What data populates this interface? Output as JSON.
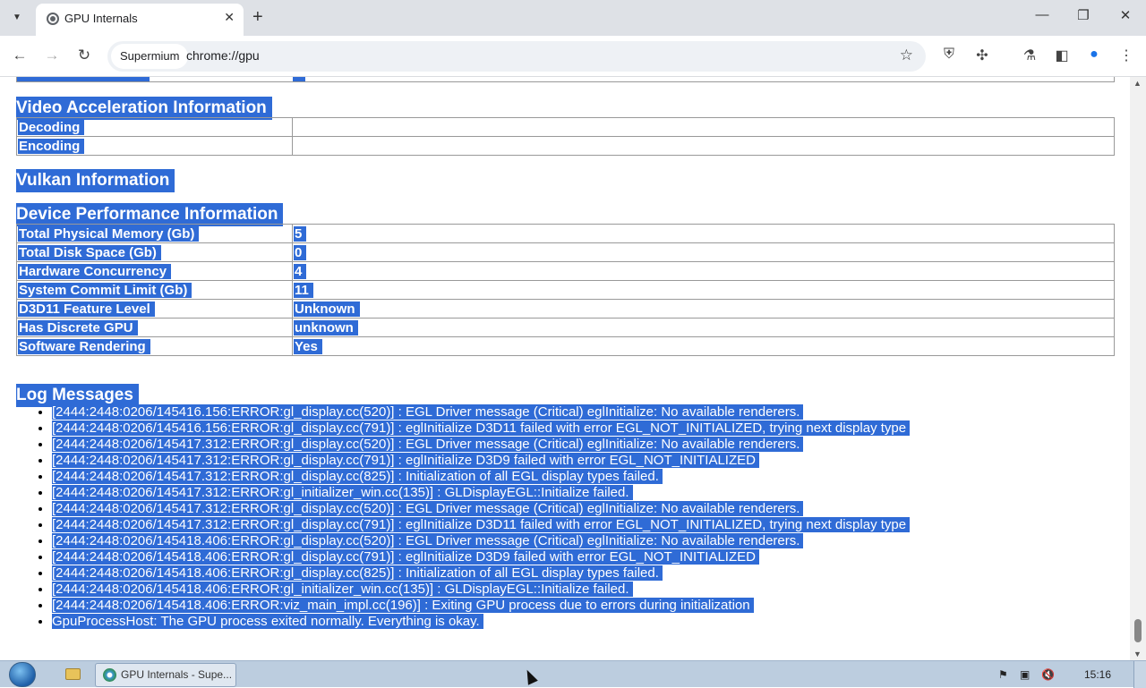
{
  "tab": {
    "title": "GPU Internals",
    "close": "✕",
    "new_tab": "+"
  },
  "window_controls": {
    "minimize": "—",
    "restore": "❐",
    "close": "✕"
  },
  "toolbar": {
    "site_chip": "Supermium",
    "url": "chrome://gpu"
  },
  "sections": {
    "video": {
      "title": "Video Acceleration Information",
      "rows": [
        {
          "key": "Decoding",
          "value": ""
        },
        {
          "key": "Encoding",
          "value": ""
        }
      ]
    },
    "vulkan": {
      "title": "Vulkan Information"
    },
    "device": {
      "title": "Device Performance Information",
      "rows": [
        {
          "key": "Total Physical Memory (Gb)",
          "value": "5"
        },
        {
          "key": "Total Disk Space (Gb)",
          "value": "0"
        },
        {
          "key": "Hardware Concurrency",
          "value": "4"
        },
        {
          "key": "System Commit Limit (Gb)",
          "value": "11"
        },
        {
          "key": "D3D11 Feature Level",
          "value": "Unknown"
        },
        {
          "key": "Has Discrete GPU",
          "value": "unknown"
        },
        {
          "key": "Software Rendering",
          "value": "Yes"
        }
      ]
    },
    "log": {
      "title": "Log Messages",
      "messages": [
        "[2444:2448:0206/145416.156:ERROR:gl_display.cc(520)] : EGL Driver message (Critical) eglInitialize: No available renderers.",
        "[2444:2448:0206/145416.156:ERROR:gl_display.cc(791)] : eglInitialize D3D11 failed with error EGL_NOT_INITIALIZED, trying next display type",
        "[2444:2448:0206/145417.312:ERROR:gl_display.cc(520)] : EGL Driver message (Critical) eglInitialize: No available renderers.",
        "[2444:2448:0206/145417.312:ERROR:gl_display.cc(791)] : eglInitialize D3D9 failed with error EGL_NOT_INITIALIZED",
        "[2444:2448:0206/145417.312:ERROR:gl_display.cc(825)] : Initialization of all EGL display types failed.",
        "[2444:2448:0206/145417.312:ERROR:gl_initializer_win.cc(135)] : GLDisplayEGL::Initialize failed.",
        "[2444:2448:0206/145417.312:ERROR:gl_display.cc(520)] : EGL Driver message (Critical) eglInitialize: No available renderers.",
        "[2444:2448:0206/145417.312:ERROR:gl_display.cc(791)] : eglInitialize D3D11 failed with error EGL_NOT_INITIALIZED, trying next display type",
        "[2444:2448:0206/145418.406:ERROR:gl_display.cc(520)] : EGL Driver message (Critical) eglInitialize: No available renderers.",
        "[2444:2448:0206/145418.406:ERROR:gl_display.cc(791)] : eglInitialize D3D9 failed with error EGL_NOT_INITIALIZED",
        "[2444:2448:0206/145418.406:ERROR:gl_display.cc(825)] : Initialization of all EGL display types failed.",
        "[2444:2448:0206/145418.406:ERROR:gl_initializer_win.cc(135)] : GLDisplayEGL::Initialize failed.",
        "[2444:2448:0206/145418.406:ERROR:viz_main_impl.cc(196)] : Exiting GPU process due to errors during initialization",
        "GpuProcessHost: The GPU process exited normally. Everything is okay."
      ]
    }
  },
  "taskbar": {
    "task_label": "GPU Internals - Supe...",
    "clock": "15:16"
  },
  "colors": {
    "selection": "#2f6bd6",
    "tabstrip": "#dee1e6",
    "taskbar": "#bccddf"
  }
}
